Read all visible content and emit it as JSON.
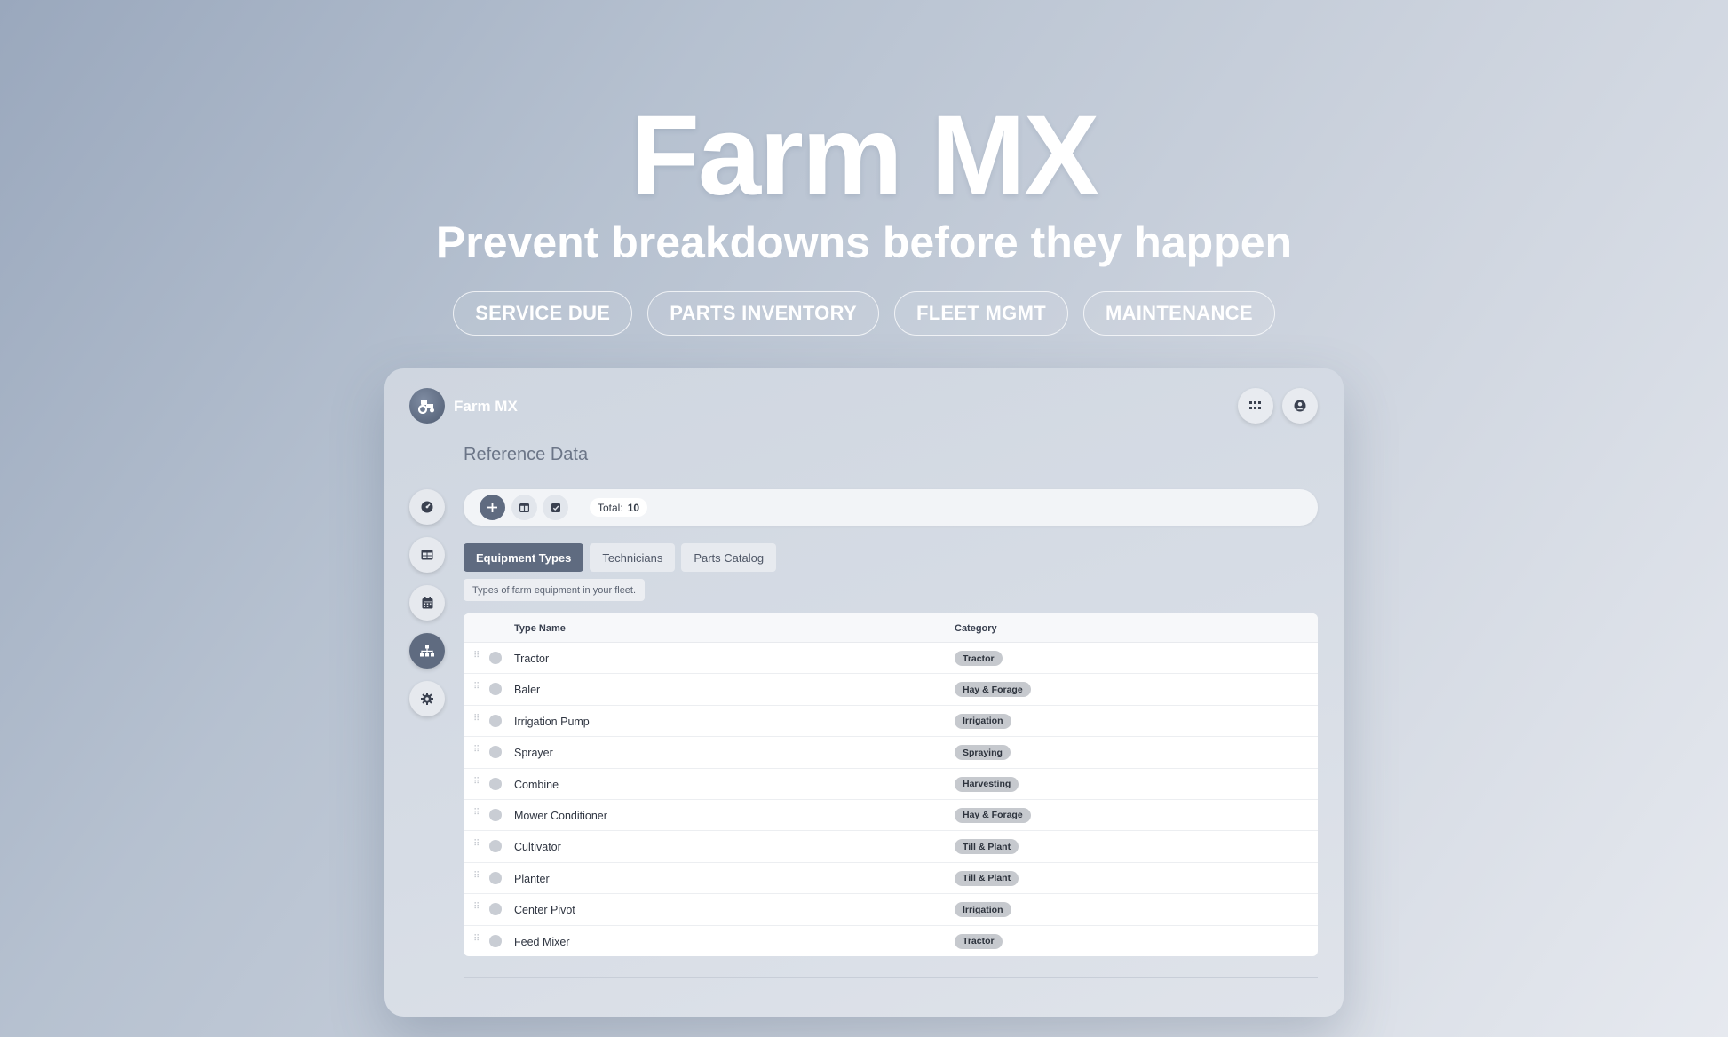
{
  "hero": {
    "title": "Farm MX",
    "subtitle": "Prevent breakdowns before they happen",
    "pills": [
      "SERVICE DUE",
      "PARTS INVENTORY",
      "FLEET MGMT",
      "MAINTENANCE"
    ]
  },
  "app": {
    "name": "Farm MX",
    "page_title": "Reference Data",
    "toolbar": {
      "total_label": "Total:",
      "total_value": "10"
    },
    "tabs": [
      "Equipment Types",
      "Technicians",
      "Parts Catalog"
    ],
    "description": "Types of farm equipment in your fleet.",
    "table": {
      "columns": [
        "Type Name",
        "Category"
      ],
      "rows": [
        {
          "name": "Tractor",
          "category": "Tractor"
        },
        {
          "name": "Baler",
          "category": "Hay & Forage"
        },
        {
          "name": "Irrigation Pump",
          "category": "Irrigation"
        },
        {
          "name": "Sprayer",
          "category": "Spraying"
        },
        {
          "name": "Combine",
          "category": "Harvesting"
        },
        {
          "name": "Mower Conditioner",
          "category": "Hay & Forage"
        },
        {
          "name": "Cultivator",
          "category": "Till & Plant"
        },
        {
          "name": "Planter",
          "category": "Till & Plant"
        },
        {
          "name": "Center Pivot",
          "category": "Irrigation"
        },
        {
          "name": "Feed Mixer",
          "category": "Tractor"
        }
      ]
    }
  },
  "colors": {
    "accent": "#5f6b80",
    "badge": "#c6c9ce"
  },
  "icons": {
    "logo": "tractor-icon",
    "top_right": [
      "apps-grid-icon",
      "user-circle-icon"
    ],
    "sidebar": [
      "dashboard-icon",
      "table-icon",
      "calendar-icon",
      "sitemap-icon",
      "gear-icon"
    ],
    "toolbar": [
      "plus-icon",
      "columns-icon",
      "checkbox-icon"
    ]
  }
}
